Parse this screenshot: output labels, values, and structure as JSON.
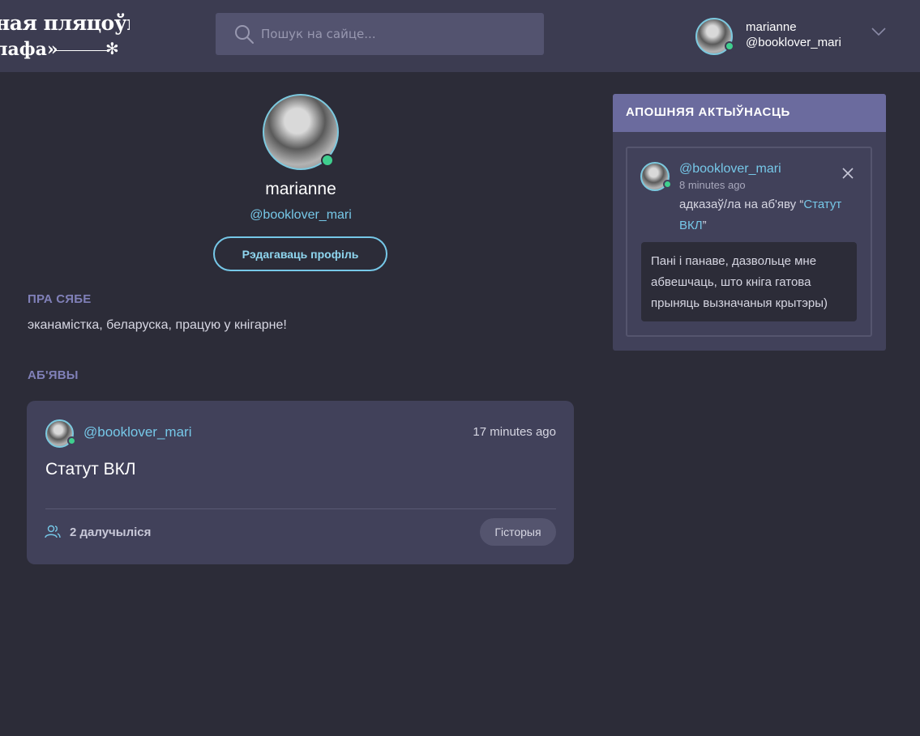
{
  "header": {
    "logo": {
      "line1": "ная пляцоўка",
      "line2": "лафа»"
    },
    "search": {
      "placeholder": "Пошук на сайце..."
    },
    "user": {
      "name": "marianne",
      "handle": "@booklover_mari"
    }
  },
  "profile": {
    "name": "marianne",
    "handle": "@booklover_mari",
    "edit_label": "Рэдагаваць профіль",
    "about_title": "ПРА СЯБЕ",
    "about_text": "эканамістка, беларуска, працую у кнігарне!",
    "posts_title": "АБ'ЯВЫ"
  },
  "posts": [
    {
      "author": "@booklover_mari",
      "time": "17 minutes ago",
      "title": "Статут ВКЛ",
      "participants": "2 далучыліся",
      "history_label": "Гісторыя"
    }
  ],
  "activity": {
    "title": "АПОШНЯЯ АКТЫЎНАСЦЬ",
    "item": {
      "author": "@booklover_mari",
      "time": "8 minutes ago",
      "text_prefix": "адказаў/ла на аб'яву “",
      "link": "Статут ВКЛ",
      "text_suffix": "”",
      "quote": "Пані і панаве, дазвольце мне абвешчаць, што кніга гатова прыняць вызначаныя крытэры)"
    }
  },
  "colors": {
    "background": "#2c2c38",
    "header": "#3c3c51",
    "accent": "#76c8e8",
    "panel_header": "#6b6b9e",
    "online": "#3fcf8e"
  }
}
